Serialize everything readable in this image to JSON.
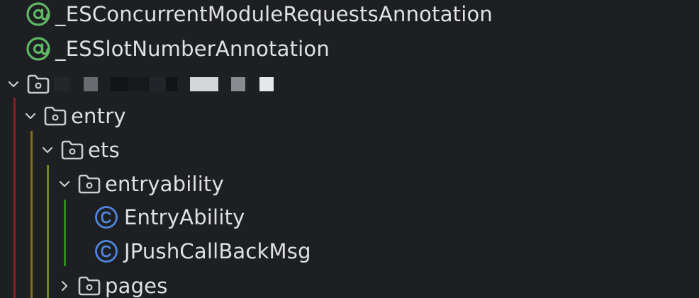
{
  "tree": {
    "items": [
      {
        "label": "_ESConcurrentModuleRequestsAnnotation",
        "icon": "annotation-icon"
      },
      {
        "label": "_ESSlotNumberAnnotation",
        "icon": "annotation-icon"
      },
      {
        "label": "",
        "icon": "folder-icon",
        "expanded": true,
        "redacted": true
      },
      {
        "label": "entry",
        "icon": "folder-icon",
        "expanded": true
      },
      {
        "label": "ets",
        "icon": "folder-icon",
        "expanded": true
      },
      {
        "label": "entryability",
        "icon": "folder-icon",
        "expanded": true
      },
      {
        "label": "EntryAbility",
        "icon": "class-icon"
      },
      {
        "label": "JPushCallBackMsg",
        "icon": "class-icon"
      },
      {
        "label": "pages",
        "icon": "folder-icon",
        "expanded": false
      }
    ]
  },
  "colors": {
    "background": "#1e1f22",
    "text": "#dfe1e5",
    "annotation_icon": "#5fb865",
    "class_icon": "#4f86e0",
    "folder_icon": "#c9ccd1",
    "guide_red": "#8a1f23",
    "guide_orange": "#8a6a1e",
    "guide_olive": "#6d8a1f",
    "guide_green": "#2f8a1f"
  }
}
